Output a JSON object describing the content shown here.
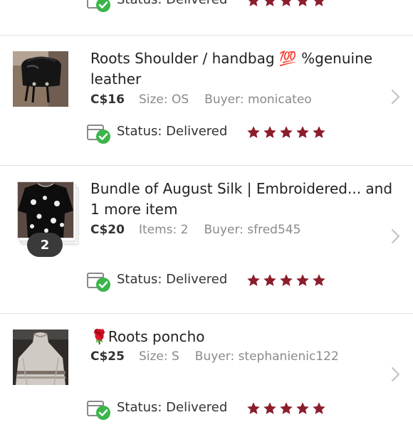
{
  "colors": {
    "star": "#8b1d2c",
    "check": "#3bb54a",
    "divider": "#e3e3e3",
    "chevron": "#c4c4c4"
  },
  "orders": [
    {
      "title": "",
      "price": "",
      "col2": "",
      "buyer": "",
      "status": "Status:  Delivered",
      "rating": 5
    },
    {
      "title": "Roots Shoulder / handbag 💯 %genuine leather",
      "price": "C$16",
      "col2": "Size: OS",
      "buyer": "Buyer: monicateo",
      "status": "Status:  Delivered",
      "rating": 5
    },
    {
      "title": "Bundle of August Silk | Embroidered... and 1 more item",
      "price": "C$20",
      "col2": "Items: 2",
      "buyer": "Buyer: sfred545",
      "status": "Status:  Delivered",
      "rating": 5,
      "badge": "2"
    },
    {
      "title": "🌹Roots poncho",
      "price": "C$25",
      "col2": "Size: S",
      "buyer": "Buyer: stephanienic122",
      "status": "Status:  Delivered",
      "rating": 5
    }
  ]
}
